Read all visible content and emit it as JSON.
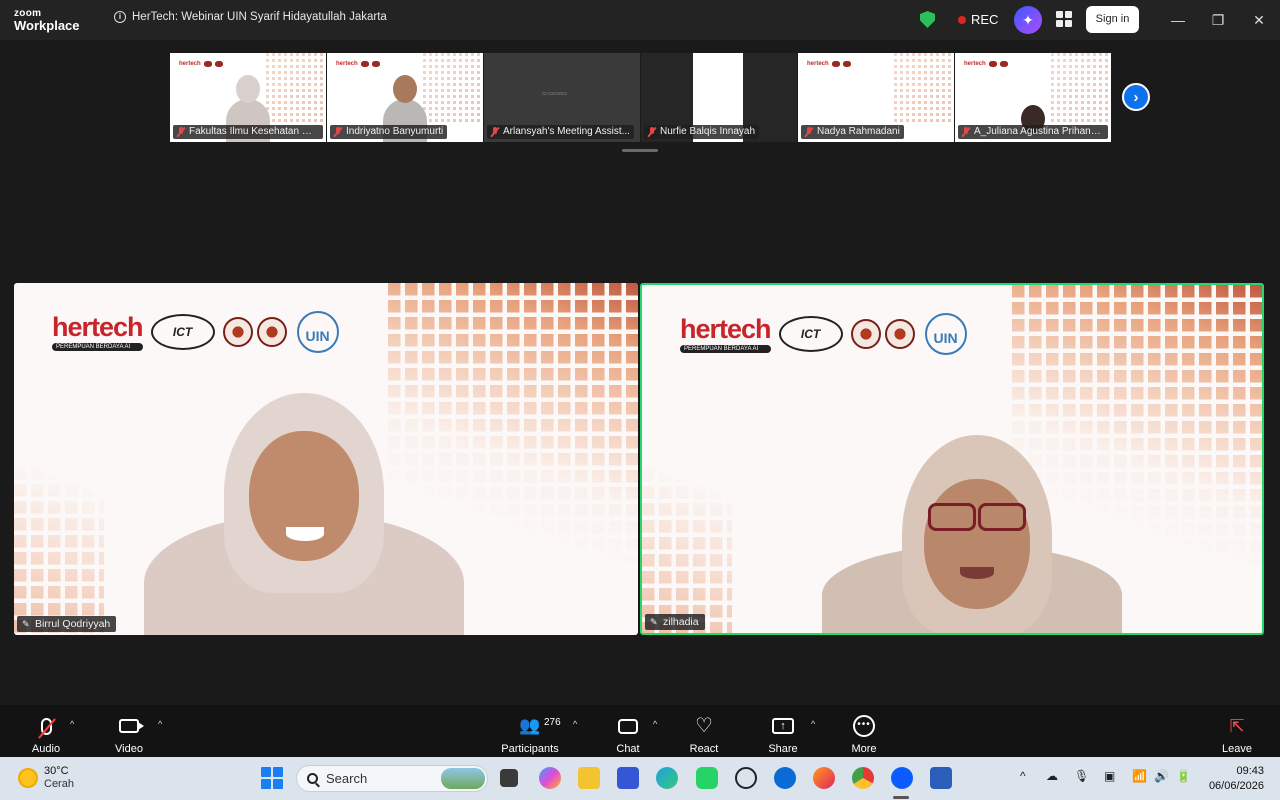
{
  "window": {
    "logo_line1": "zoom",
    "logo_line2": "Workplace",
    "title": "HerTech: Webinar UIN Syarif Hidayatullah Jakarta",
    "rec_label": "REC",
    "signin_label": "Sign in",
    "security_color": "#2dbf5a",
    "rec_color": "#e02424"
  },
  "thumbnails": [
    {
      "name": "Fakultas Ilmu Kesehatan UI...",
      "muted": true
    },
    {
      "name": "Indriyatno Banyumurti",
      "muted": true
    },
    {
      "name": "Arlansyah's Meeting Assist...",
      "muted": true
    },
    {
      "name": "Nurfie Balqis Innayah",
      "muted": true
    },
    {
      "name": "Nadya Rahmadani",
      "muted": true
    },
    {
      "name": "A_Juliana Agustina Prihand...",
      "muted": true
    }
  ],
  "main_tiles": {
    "left": {
      "name": "Birrul Qodriyyah",
      "muted": true,
      "pinned": true
    },
    "right": {
      "name": "zilhadia",
      "pinned": true,
      "active_speaker": true,
      "highlight_color": "#23d96b"
    }
  },
  "slide_branding": {
    "hertech": "hertech",
    "hertech_sub": "PEREMPUAN BERDAYA AI",
    "ict": "ICT",
    "uin": "UIN"
  },
  "toolbar": {
    "audio": "Audio",
    "video": "Video",
    "participants": "Participants",
    "participants_count": "276",
    "chat": "Chat",
    "react": "React",
    "share": "Share",
    "more": "More",
    "leave": "Leave"
  },
  "taskbar": {
    "temperature": "30°C",
    "condition": "Cerah",
    "search_placeholder": "Search",
    "time": "09:43",
    "date": "06/06/2026"
  }
}
